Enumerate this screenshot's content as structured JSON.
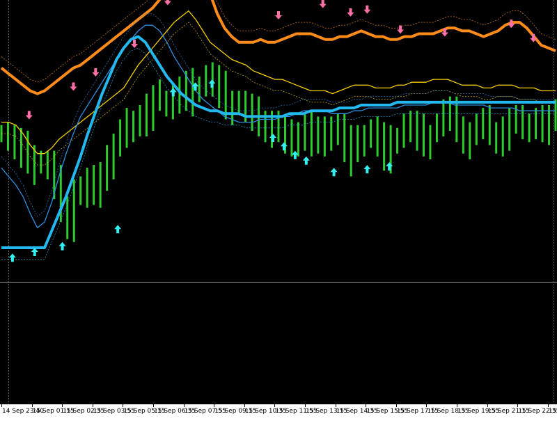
{
  "chart_data": {
    "type": "line",
    "time_labels": [
      "14 Sep 23:40",
      "15 Sep 01:15",
      "15 Sep 02:35",
      "15 Sep 03:55",
      "15 Sep 05:15",
      "15 Sep 06:35",
      "15 Sep 07:55",
      "15 Sep 09:15",
      "15 Sep 10:35",
      "15 Sep 11:55",
      "15 Sep 13:15",
      "15 Sep 14:35",
      "15 Sep 15:55",
      "15 Sep 17:15",
      "15 Sep 18:35",
      "15 Sep 19:55",
      "15 Sep 21:15",
      "15 Sep 22:35",
      "15 Se"
    ],
    "x_index_range": [
      0,
      100
    ],
    "price_range": [
      0,
      100
    ],
    "horizontal_level": 0,
    "grid": false,
    "price_close": [
      80,
      78,
      76,
      74,
      73,
      70,
      69,
      68,
      62,
      55,
      50,
      60,
      58,
      62,
      60,
      67,
      72,
      75,
      79,
      82,
      85,
      86,
      89,
      91,
      92,
      90,
      93,
      95,
      96,
      94,
      97,
      100,
      98,
      95,
      92,
      91,
      90,
      88,
      86,
      85,
      84,
      83,
      80,
      77,
      78,
      81,
      83,
      80,
      76,
      79,
      83,
      82,
      77,
      73,
      76,
      80,
      81,
      78,
      74,
      76,
      79,
      83,
      82,
      80,
      79,
      80,
      83,
      87,
      86,
      83,
      80,
      79,
      82,
      83,
      81,
      79,
      82,
      84,
      83,
      82,
      84,
      85,
      84,
      84,
      85
    ],
    "series": [
      {
        "name": "",
        "color": "#ff8c1a",
        "style": "thick",
        "values": [
          103,
          101,
          99,
          97,
          95,
          94,
          95,
          97,
          99,
          101,
          103,
          104,
          106,
          108,
          110,
          112,
          114,
          116,
          118,
          120,
          122,
          124,
          127,
          130,
          133,
          136,
          139,
          140,
          136,
          129,
          122,
          117,
          114,
          112,
          112,
          112,
          113,
          112,
          112,
          113,
          114,
          115,
          115,
          115,
          114,
          113,
          113,
          114,
          114,
          115,
          116,
          115,
          114,
          114,
          113,
          113,
          114,
          114,
          115,
          115,
          115,
          116,
          117,
          117,
          116,
          116,
          115,
          114,
          115,
          116,
          118,
          119,
          119,
          117,
          114,
          111,
          110,
          109
        ]
      },
      {
        "name": "",
        "color": "#f5d000",
        "style": "thin",
        "values": [
          84,
          84,
          83,
          80,
          76,
          73,
          73,
          75,
          78,
          80,
          82,
          84,
          86,
          88,
          90,
          92,
          94,
          96,
          100,
          104,
          107,
          110,
          113,
          116,
          119,
          121,
          123,
          120,
          116,
          112,
          110,
          108,
          106,
          105,
          104,
          102,
          101,
          100,
          99,
          99,
          98,
          97,
          96,
          95,
          95,
          95,
          94,
          95,
          96,
          97,
          97,
          97,
          96,
          96,
          96,
          97,
          97,
          98,
          98,
          98,
          99,
          99,
          99,
          98,
          97,
          97,
          97,
          96,
          96,
          97,
          97,
          97,
          96,
          96,
          96,
          95,
          95,
          95
        ]
      },
      {
        "name": "",
        "color": "#2f8fe0",
        "style": "thin",
        "values": [
          68,
          65,
          62,
          58,
          52,
          47,
          49,
          56,
          65,
          73,
          80,
          86,
          90,
          94,
          98,
          102,
          106,
          110,
          113,
          116,
          118,
          118,
          116,
          112,
          107,
          103,
          99,
          95,
          92,
          90,
          88,
          86,
          85,
          84,
          84,
          84,
          85,
          85,
          85,
          86,
          86,
          87,
          88,
          88,
          88,
          88,
          87,
          87,
          87,
          88,
          88,
          89,
          89,
          89,
          89,
          89,
          90,
          90,
          90,
          90,
          91,
          91,
          91,
          90,
          90,
          90,
          90,
          90,
          89,
          89,
          89,
          89,
          88,
          88,
          88,
          88,
          88,
          88
        ]
      },
      {
        "name": "",
        "color": "#23b8f0",
        "style": "thick",
        "values": [
          40,
          40,
          40,
          40,
          40,
          40,
          40,
          46,
          52,
          58,
          65,
          72,
          80,
          87,
          94,
          100,
          106,
          110,
          113,
          114,
          112,
          108,
          104,
          100,
          97,
          94,
          92,
          90,
          89,
          88,
          88,
          87,
          87,
          87,
          86,
          86,
          86,
          86,
          86,
          86,
          87,
          87,
          87,
          88,
          88,
          88,
          88,
          89,
          89,
          89,
          90,
          90,
          90,
          90,
          90,
          91,
          91,
          91,
          91,
          91,
          91,
          91,
          91,
          91,
          91,
          91,
          91,
          91,
          91,
          91,
          91,
          91,
          91,
          91,
          91,
          91,
          91,
          91
        ]
      }
    ],
    "signals_sell": [
      [
        5,
        85
      ],
      [
        13,
        95
      ],
      [
        17,
        100
      ],
      [
        24,
        110
      ],
      [
        30,
        125
      ],
      [
        38,
        128
      ],
      [
        50,
        120
      ],
      [
        58,
        124
      ],
      [
        63,
        121
      ],
      [
        66,
        122
      ],
      [
        72,
        115
      ],
      [
        80,
        114
      ],
      [
        92,
        117
      ],
      [
        96,
        112
      ]
    ],
    "signals_buy": [
      [
        2,
        38
      ],
      [
        6,
        40
      ],
      [
        11,
        42
      ],
      [
        21,
        48
      ],
      [
        31,
        96
      ],
      [
        35,
        98
      ],
      [
        38,
        99
      ],
      [
        49,
        80
      ],
      [
        51,
        77
      ],
      [
        53,
        74
      ],
      [
        55,
        72
      ],
      [
        60,
        68
      ],
      [
        66,
        69
      ],
      [
        70,
        70
      ]
    ]
  }
}
